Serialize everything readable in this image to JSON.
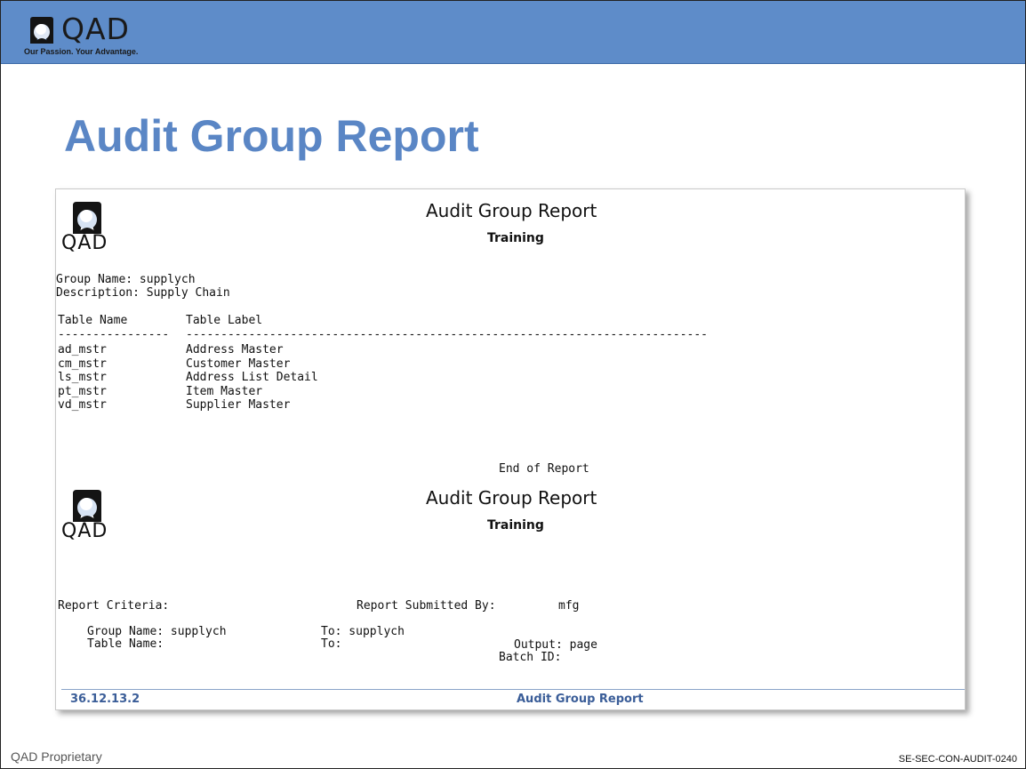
{
  "header": {
    "logo_text": "QAD",
    "tagline": "Our Passion. Your Advantage."
  },
  "slide_title": "Audit Group Report",
  "report": {
    "logo_text": "QAD",
    "title": "Audit Group Report",
    "subtitle": "Training",
    "group_name_line": "Group Name: supplych",
    "description_line": "Description: Supply Chain",
    "columns": [
      "Table Name",
      "Table Label"
    ],
    "separator_1": "----------------",
    "separator_2": "---------------------------------------------------------------------------",
    "rows": [
      {
        "name": "ad_mstr",
        "label": "Address Master"
      },
      {
        "name": "cm_mstr",
        "label": "Customer Master"
      },
      {
        "name": "ls_mstr",
        "label": "Address List Detail"
      },
      {
        "name": "pt_mstr",
        "label": "Item Master"
      },
      {
        "name": "vd_mstr",
        "label": "Supplier Master"
      }
    ],
    "end_text": "End of Report",
    "page2": {
      "logo_text": "QAD",
      "title": "Audit Group Report",
      "subtitle": "Training",
      "criteria_label": "Report Criteria:",
      "submitted_by_label": "Report Submitted By:",
      "submitted_by_value": "mfg",
      "group_name_label": "Group Name: supplych",
      "group_to": "To: supplych",
      "table_name_label": "Table Name:",
      "table_to": "To:",
      "output_label": "Output: page",
      "batch_label": "Batch ID:"
    },
    "footer": {
      "program": "36.12.13.2",
      "name": "Audit Group Report"
    }
  },
  "slide_footer": {
    "left": "QAD Proprietary",
    "right": "SE-SEC-CON-AUDIT-0240"
  }
}
